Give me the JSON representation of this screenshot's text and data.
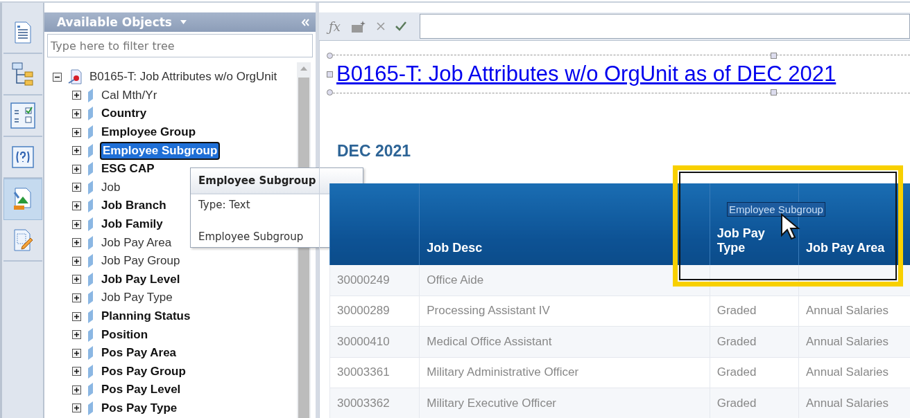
{
  "side_toolbar": {
    "items": [
      {
        "selected": false
      },
      {
        "selected": false
      },
      {
        "selected": false
      },
      {
        "selected": false
      },
      {
        "selected": true
      },
      {
        "selected": false
      }
    ]
  },
  "objects_panel": {
    "title": "Available Objects",
    "filter": {
      "placeholder": "Type here to filter tree"
    },
    "tree": {
      "label": "B0165-T: Job Attributes w/o OrgUnit",
      "expanded": true,
      "children": [
        {
          "label": "Cal Mth/Yr",
          "emphasized": false,
          "selected": false
        },
        {
          "label": "Country",
          "emphasized": true,
          "selected": false
        },
        {
          "label": "Employee Group",
          "emphasized": true,
          "selected": false
        },
        {
          "label": "Employee Subgroup",
          "emphasized": true,
          "selected": true
        },
        {
          "label": "ESG CAP",
          "emphasized": true,
          "selected": false
        },
        {
          "label": "Job",
          "emphasized": false,
          "selected": false
        },
        {
          "label": "Job Branch",
          "emphasized": true,
          "selected": false
        },
        {
          "label": "Job Family",
          "emphasized": true,
          "selected": false
        },
        {
          "label": "Job Pay Area",
          "emphasized": false,
          "selected": false
        },
        {
          "label": "Job Pay Group",
          "emphasized": false,
          "selected": false
        },
        {
          "label": "Job Pay Level",
          "emphasized": true,
          "selected": false
        },
        {
          "label": "Job Pay Type",
          "emphasized": false,
          "selected": false
        },
        {
          "label": "Planning Status",
          "emphasized": true,
          "selected": false
        },
        {
          "label": "Position",
          "emphasized": true,
          "selected": false
        },
        {
          "label": "Pos Pay Area",
          "emphasized": true,
          "selected": false
        },
        {
          "label": "Pos Pay Group",
          "emphasized": true,
          "selected": false
        },
        {
          "label": "Pos Pay Level",
          "emphasized": true,
          "selected": false
        },
        {
          "label": "Pos Pay Type",
          "emphasized": true,
          "selected": false
        }
      ]
    },
    "tooltip": {
      "title": "Employee Subgroup",
      "type": "Type: Text",
      "description": "Employee Subgroup"
    }
  },
  "report": {
    "formula_label": "ƒx",
    "title": "B0165-T: Job Attributes w/o OrgUnit as of DEC 2021",
    "subtitle": "DEC 2021",
    "drag_label": "Employee Subgroup",
    "table": {
      "columns": [
        "Job Desc",
        "Job Pay Type",
        "Job Pay Area"
      ],
      "rows": [
        {
          "column_1": "30000249",
          "job_desc": "Office Aide"
        },
        {
          "column_1": "30000289",
          "job_desc": "Processing Assistant IV",
          "job_pay_type": "Graded",
          "job_pay_area": "Annual Salaries"
        },
        {
          "column_1": "30000410",
          "job_desc": "Medical Office Assistant",
          "job_pay_type": "Graded",
          "job_pay_area": "Annual Salaries"
        },
        {
          "column_1": "30003361",
          "job_desc": "Military Administrative Officer",
          "job_pay_type": "Graded",
          "job_pay_area": "Annual Salaries"
        },
        {
          "column_1": "30003362",
          "job_desc": "Military Executive Officer",
          "job_pay_type": "Graded",
          "job_pay_area": "Annual Salaries"
        }
      ]
    }
  }
}
